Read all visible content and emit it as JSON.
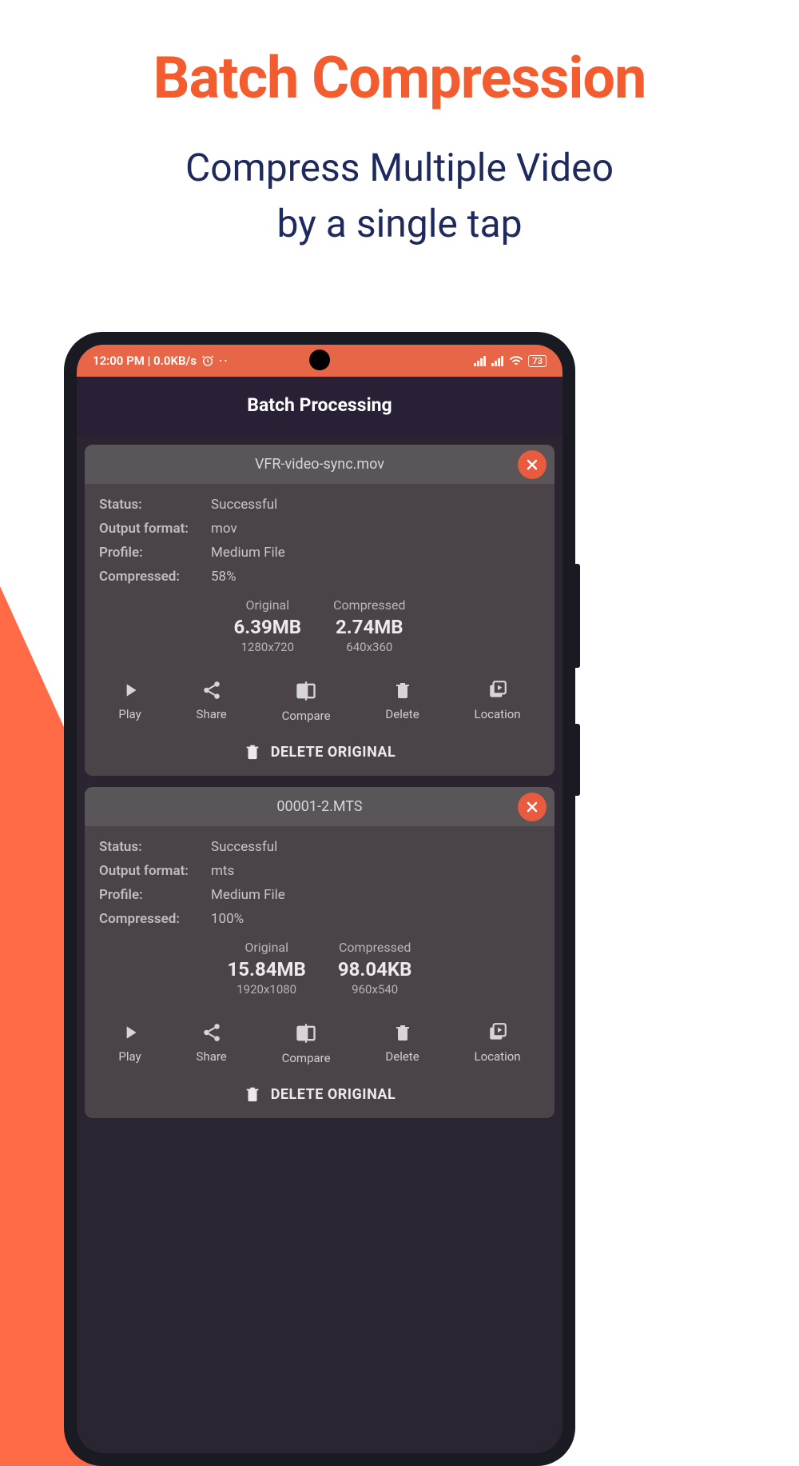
{
  "marketing": {
    "headline": "Batch Compression",
    "subhead_line1": "Compress Multiple Video",
    "subhead_line2": "by a single tap"
  },
  "statusbar": {
    "time_net": "12:00 PM | 0.0KB/s",
    "battery": "73"
  },
  "appbar": {
    "title": "Batch Processing"
  },
  "labels": {
    "status": "Status:",
    "output_format": "Output format:",
    "profile": "Profile:",
    "compressed": "Compressed:",
    "original_col": "Original",
    "compressed_col": "Compressed"
  },
  "actions": {
    "play": "Play",
    "share": "Share",
    "compare": "Compare",
    "delete": "Delete",
    "location": "Location",
    "delete_original": "DELETE ORIGINAL"
  },
  "cards": [
    {
      "filename": "VFR-video-sync.mov",
      "status": "Successful",
      "output_format": "mov",
      "profile": "Medium File",
      "compressed_pct": "58%",
      "original_size": "6.39MB",
      "original_res": "1280x720",
      "compressed_size": "2.74MB",
      "compressed_res": "640x360"
    },
    {
      "filename": "00001-2.MTS",
      "status": "Successful",
      "output_format": "mts",
      "profile": "Medium File",
      "compressed_pct": "100%",
      "original_size": "15.84MB",
      "original_res": "1920x1080",
      "compressed_size": "98.04KB",
      "compressed_res": "960x540"
    }
  ]
}
